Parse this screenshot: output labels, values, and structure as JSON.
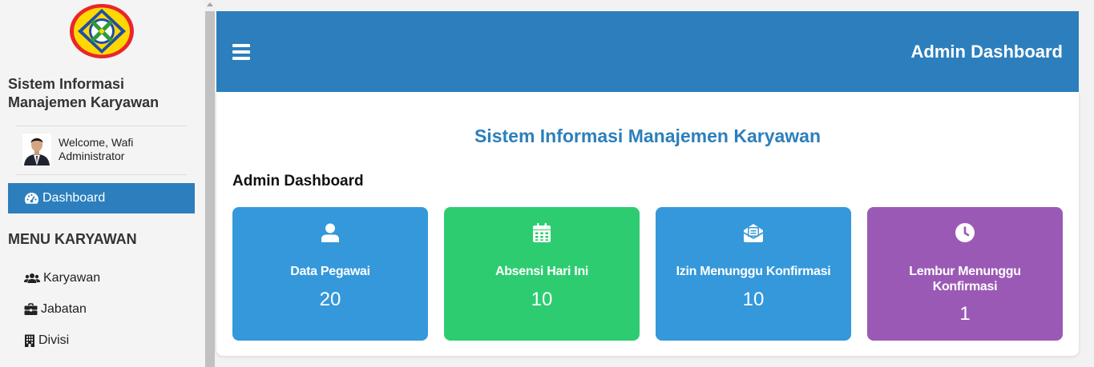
{
  "sidebar": {
    "app_title": "Sistem Informasi Manajemen Karyawan",
    "user": {
      "welcome": "Welcome, Wafi",
      "role": "Administrator"
    },
    "active_item": {
      "label": "Dashboard",
      "icon": "dashboard-icon"
    },
    "section_title": "MENU KARYAWAN",
    "items": [
      {
        "label": "Karyawan",
        "icon": "users-icon"
      },
      {
        "label": "Jabatan",
        "icon": "briefcase-icon"
      },
      {
        "label": "Divisi",
        "icon": "building-icon"
      }
    ]
  },
  "header": {
    "title": "Admin Dashboard"
  },
  "main": {
    "title": "Sistem Informasi Manajemen Karyawan",
    "subtitle": "Admin Dashboard",
    "cards": [
      {
        "label": "Data Pegawai",
        "value": "20",
        "icon": "user-icon",
        "color": "#3498db"
      },
      {
        "label": "Absensi Hari Ini",
        "value": "10",
        "icon": "calendar-icon",
        "color": "#2ecc71"
      },
      {
        "label": "Izin Menunggu Konfirmasi",
        "value": "10",
        "icon": "envelope-icon",
        "color": "#3498db"
      },
      {
        "label": "Lembur Menunggu Konfirmasi",
        "value": "1",
        "icon": "clock-icon",
        "color": "#9b59b6"
      }
    ]
  },
  "colors": {
    "primary": "#2c7fbc",
    "sidebar_bg": "#f4f4f4"
  }
}
